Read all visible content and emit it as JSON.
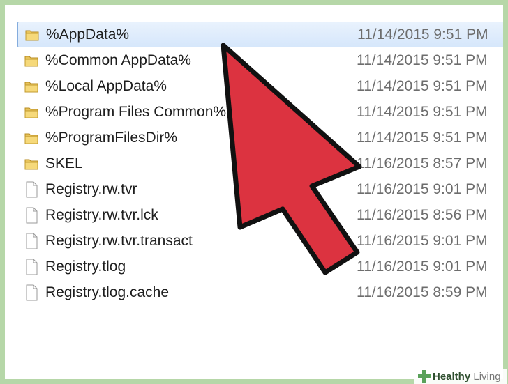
{
  "files": [
    {
      "name": "%AppData%",
      "date": "11/14/2015 9:51 PM",
      "type": "folder",
      "selected": true
    },
    {
      "name": "%Common AppData%",
      "date": "11/14/2015 9:51 PM",
      "type": "folder"
    },
    {
      "name": "%Local AppData%",
      "date": "11/14/2015 9:51 PM",
      "type": "folder"
    },
    {
      "name": "%Program Files Common%",
      "date": "11/14/2015 9:51 PM",
      "type": "folder"
    },
    {
      "name": "%ProgramFilesDir%",
      "date": "11/14/2015 9:51 PM",
      "type": "folder"
    },
    {
      "name": "SKEL",
      "date": "11/16/2015 8:57 PM",
      "type": "folder"
    },
    {
      "name": "Registry.rw.tvr",
      "date": "11/16/2015 9:01 PM",
      "type": "file"
    },
    {
      "name": "Registry.rw.tvr.lck",
      "date": "11/16/2015 8:56 PM",
      "type": "file"
    },
    {
      "name": "Registry.rw.tvr.transact",
      "date": "11/16/2015 9:01 PM",
      "type": "file"
    },
    {
      "name": "Registry.tlog",
      "date": "11/16/2015 9:01 PM",
      "type": "file"
    },
    {
      "name": "Registry.tlog.cache",
      "date": "11/16/2015 8:59 PM",
      "type": "file"
    }
  ],
  "watermark": {
    "brand": "Healthy",
    "suffix": "Living"
  },
  "colors": {
    "arrow": "#dc3340",
    "selection": "#d6e7fb",
    "background": "#b6d7a8"
  }
}
